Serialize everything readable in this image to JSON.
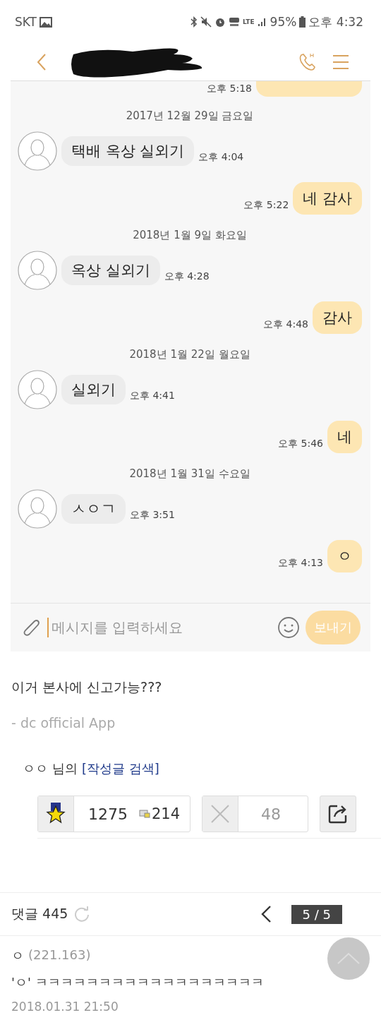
{
  "status_bar": {
    "carrier": "SKT",
    "battery": "95%",
    "time": "오후 4:32",
    "network": "LTE"
  },
  "chat": {
    "messages": [
      {
        "kind": "partial_out",
        "time": "오후 5:18"
      },
      {
        "kind": "date",
        "text": "2017년 12월 29일 금요일"
      },
      {
        "kind": "in",
        "text": "택배 옥상 실외기",
        "time": "오후 4:04"
      },
      {
        "kind": "out",
        "text": "네 감사",
        "time": "오후 5:22"
      },
      {
        "kind": "date",
        "text": "2018년 1월 9일 화요일"
      },
      {
        "kind": "in",
        "text": "옥상 실외기",
        "time": "오후 4:28"
      },
      {
        "kind": "out",
        "text": "감사",
        "time": "오후 4:48"
      },
      {
        "kind": "date",
        "text": "2018년 1월 22일 월요일"
      },
      {
        "kind": "in",
        "text": "실외기",
        "time": "오후 4:41"
      },
      {
        "kind": "out",
        "text": "네",
        "time": "오후 5:46"
      },
      {
        "kind": "date",
        "text": "2018년 1월 31일 수요일"
      },
      {
        "kind": "in",
        "text": "ㅅㅇㄱ",
        "time": "오후 3:51"
      },
      {
        "kind": "out",
        "text": "ㅇ",
        "time": "오후 4:13"
      }
    ],
    "input": {
      "placeholder": "메시지를 입력하세요",
      "send": "보내기"
    }
  },
  "post": {
    "body": "이거 본사에 신고가능???",
    "signature": "- dc official App",
    "author": "ㅇㅇ",
    "author_suffix": "님의",
    "author_link": "[작성글 검색]",
    "recommend": "1275",
    "fix_recommend": "214",
    "downvote": "48"
  },
  "comments": {
    "label": "댓글 445",
    "page": "5 / 5",
    "items": [
      {
        "name": "ㅇ",
        "ip": "(221.163)",
        "text": "'ㅇ' ㅋㅋㅋㅋㅋㅋㅋㅋㅋㅋㅋㅋㅋㅋㅋㅋㅋㅋ",
        "date": "2018.01.31 21:50"
      }
    ]
  }
}
